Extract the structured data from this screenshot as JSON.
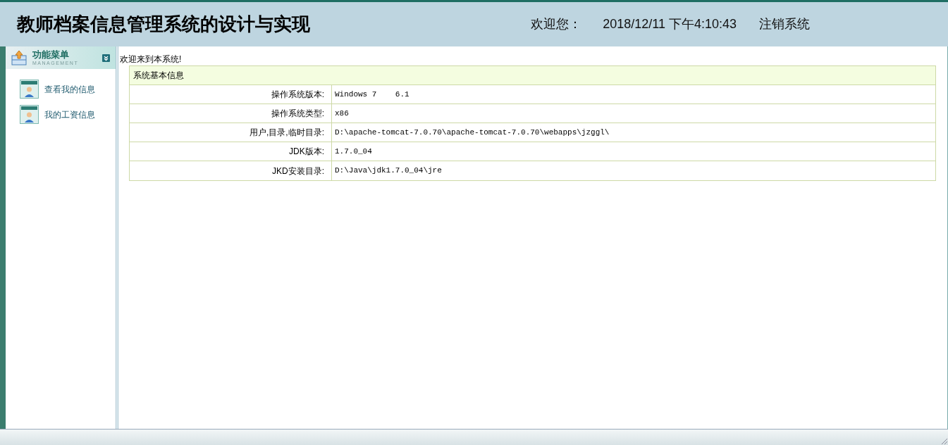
{
  "header": {
    "title": "教师档案信息管理系统的设计与实现",
    "welcome": "欢迎您：",
    "datetime": "2018/12/11 下午4:10:43",
    "logout": "注销系统"
  },
  "sidebar": {
    "title": "功能菜单",
    "subtitle": "MANAGEMENT",
    "items": [
      {
        "label": "查看我的信息"
      },
      {
        "label": "我的工资信息"
      }
    ]
  },
  "content": {
    "greeting": "欢迎来到本系统!",
    "table": {
      "title": "系统基本信息",
      "rows": [
        {
          "label": "操作系统版本:",
          "value": "Windows 7    6.1"
        },
        {
          "label": "操作系统类型:",
          "value": "x86"
        },
        {
          "label": "用户,目录,临时目录:",
          "value": "D:\\apache-tomcat-7.0.70\\apache-tomcat-7.0.70\\webapps\\jzggl\\"
        },
        {
          "label": "JDK版本:",
          "value": "1.7.0_04"
        },
        {
          "label": "JKD安装目录:",
          "value": "D:\\Java\\jdk1.7.0_04\\jre"
        }
      ]
    }
  }
}
